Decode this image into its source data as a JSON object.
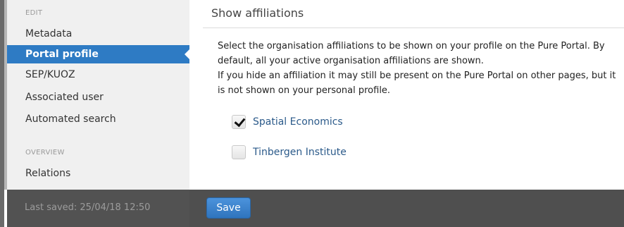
{
  "sidebar": {
    "edit_heading": "EDIT",
    "items": [
      {
        "label": "Metadata"
      },
      {
        "label": "Portal profile"
      },
      {
        "label": "SEP/KUOZ"
      },
      {
        "label": "Associated user"
      },
      {
        "label": "Automated search"
      }
    ],
    "active_item": "Portal profile",
    "overview_heading": "OVERVIEW",
    "overview_items": [
      {
        "label": "Relations"
      }
    ]
  },
  "main": {
    "title": "Show affiliations",
    "description": [
      "Select the organisation affiliations to be shown on your profile on the Pure Portal. By default, all your active organisation affiliations are shown.",
      "If you hide an affiliation it may still be present on the Pure Portal on other pages, but it is not shown on your personal profile."
    ],
    "affiliations": [
      {
        "label": "Spatial Economics",
        "checked": true
      },
      {
        "label": "Tinbergen Institute",
        "checked": false
      }
    ]
  },
  "footer": {
    "last_saved": "Last saved: 25/04/18 12:50",
    "save_label": "Save"
  },
  "colors": {
    "active_nav": "#2e7bc4",
    "link": "#2b5a8a",
    "footer": "#4f4f4f",
    "save_button": "#3a84cf"
  }
}
